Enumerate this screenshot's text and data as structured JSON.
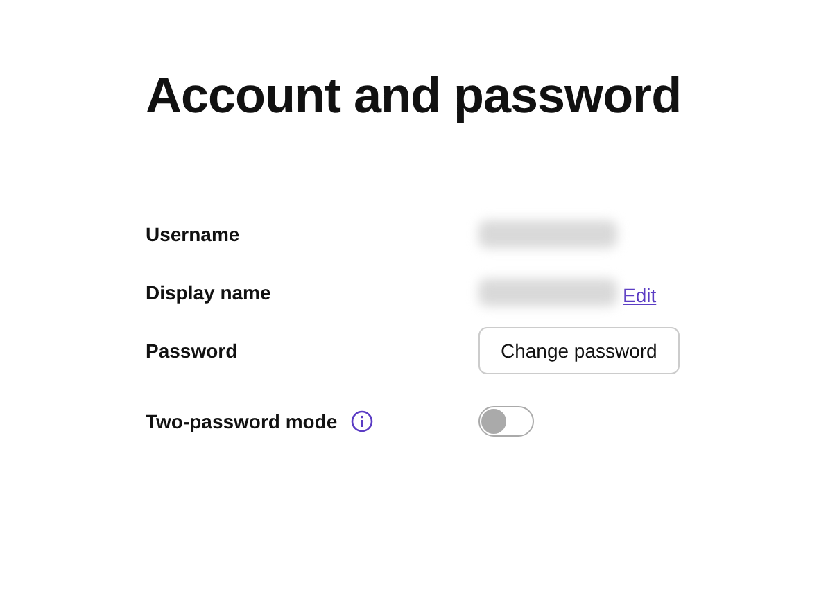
{
  "title": "Account and password",
  "rows": [
    {
      "label": "Username",
      "kind": "redacted"
    },
    {
      "label": "Display name",
      "kind": "redacted",
      "link": "Edit"
    },
    {
      "label": "Password",
      "kind": "button",
      "button": "Change password"
    },
    {
      "label": "Two-password mode",
      "kind": "toggle",
      "info": true,
      "on": false
    }
  ]
}
